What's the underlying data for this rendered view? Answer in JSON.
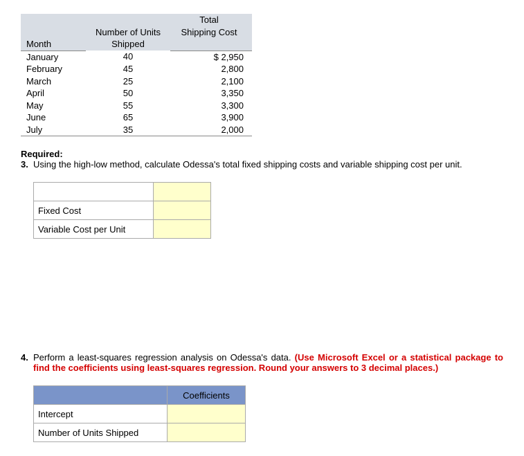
{
  "data_table": {
    "headers": {
      "month": "Month",
      "units": "Number of Units Shipped",
      "cost_top": "Total",
      "cost_bottom": "Shipping Cost"
    },
    "rows": [
      {
        "month": "January",
        "units": "40",
        "cost": "$ 2,950"
      },
      {
        "month": "February",
        "units": "45",
        "cost": "2,800"
      },
      {
        "month": "March",
        "units": "25",
        "cost": "2,100"
      },
      {
        "month": "April",
        "units": "50",
        "cost": "3,350"
      },
      {
        "month": "May",
        "units": "55",
        "cost": "3,300"
      },
      {
        "month": "June",
        "units": "65",
        "cost": "3,900"
      },
      {
        "month": "July",
        "units": "35",
        "cost": "2,000"
      }
    ]
  },
  "required_label": "Required:",
  "q3": {
    "num": "3.",
    "text": "Using the high-low method, calculate Odessa's total fixed shipping costs and variable shipping cost per unit.",
    "row1": "Fixed Cost",
    "row2": "Variable Cost per Unit"
  },
  "q4": {
    "num": "4.",
    "text_plain": "Perform a least-squares regression analysis on Odessa's data. ",
    "text_red": "(Use Microsoft Excel or a statistical package to find the coefficients using least-squares regression. Round your answers to 3 decimal places.)",
    "coeff_header": "Coefficients",
    "row1": "Intercept",
    "row2": "Number of Units Shipped"
  }
}
